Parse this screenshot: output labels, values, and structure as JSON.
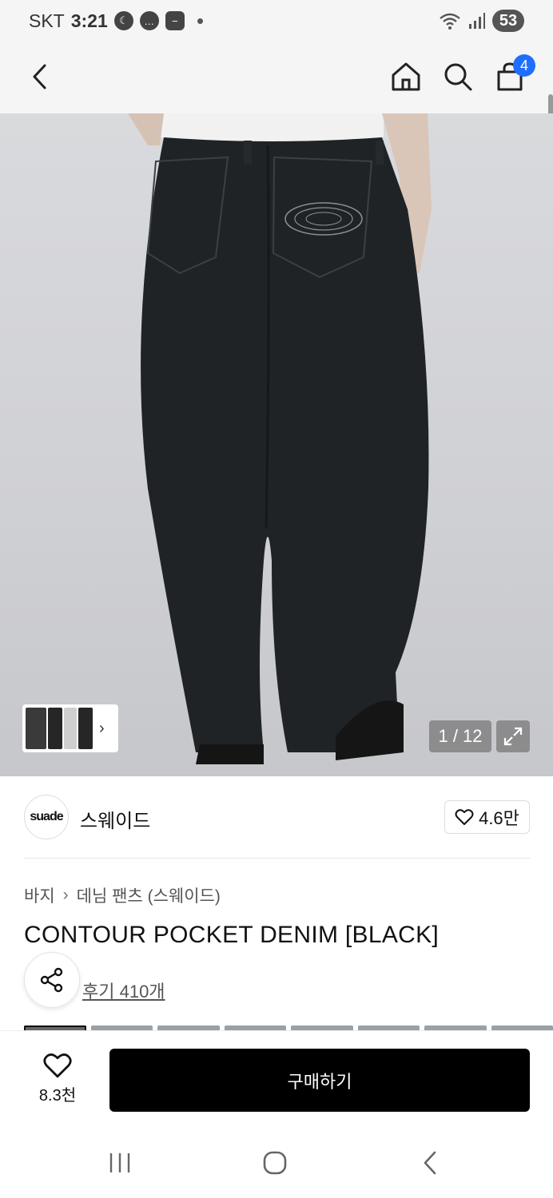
{
  "status_bar": {
    "carrier": "SKT",
    "time": "3:21",
    "battery": "53"
  },
  "top_nav": {
    "cart_count": "4"
  },
  "hero": {
    "page_counter": "1 / 12"
  },
  "brand": {
    "logo_text": "suade",
    "name": "스웨이드",
    "likes": "4.6만"
  },
  "product": {
    "breadcrumb": [
      "바지",
      "데님 팬츠 (스웨이드)"
    ],
    "title": "CONTOUR POCKET DENIM [BLACK]",
    "review_link": "후기 410개"
  },
  "bottom_bar": {
    "wish_count": "8.3천",
    "buy_label": "구매하기"
  },
  "icons": {
    "back": "chevron-left-icon",
    "home": "home-icon",
    "search": "search-icon",
    "cart": "shopping-bag-icon",
    "share": "share-icon",
    "heart": "heart-icon",
    "expand": "expand-icon"
  },
  "colors": {
    "accent_badge": "#1f6fff",
    "buy_button": "#000000"
  }
}
